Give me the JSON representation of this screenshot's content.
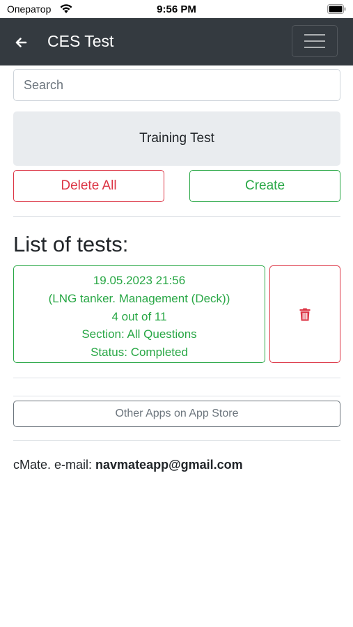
{
  "status_bar": {
    "carrier": "Оператор",
    "time": "9:56 PM"
  },
  "navbar": {
    "title": "CES Test"
  },
  "search": {
    "placeholder": "Search"
  },
  "training_test": {
    "label": "Training Test"
  },
  "actions": {
    "delete_all_label": "Delete All",
    "create_label": "Create"
  },
  "list": {
    "heading": "List of tests:",
    "tests": [
      {
        "date": "19.05.2023 21:56",
        "name": "(LNG tanker. Management (Deck))",
        "score": "4 out of 11",
        "section": "Section: All Questions",
        "status": "Status: Completed"
      }
    ]
  },
  "other_apps": {
    "label": "Other Apps on App Store"
  },
  "footer": {
    "prefix": "cMate. e-mail: ",
    "email": "navmateapp@gmail.com"
  },
  "colors": {
    "navbar_bg": "#343a40",
    "success": "#28a745",
    "danger": "#dc3545",
    "secondary": "#6c757d",
    "light_bg": "#e9ecef"
  }
}
